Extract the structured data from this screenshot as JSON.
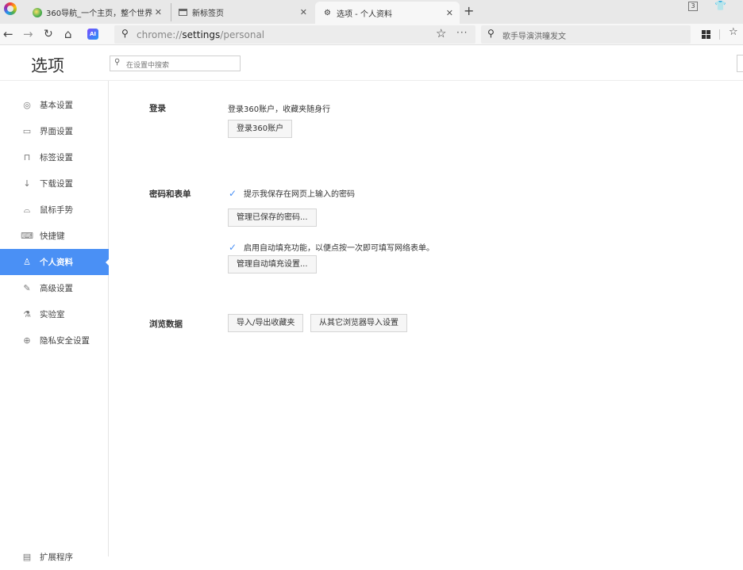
{
  "tabs": [
    {
      "title": "360导航_一个主页，整个世界",
      "icon": "globe-icon"
    },
    {
      "title": "新标签页",
      "icon": "newtab-page-icon"
    },
    {
      "title": "选项 - 个人资料",
      "icon": "settings-gear-icon"
    }
  ],
  "window": {
    "badge": "3"
  },
  "toolbar": {
    "url_scheme": "chrome://",
    "url_host": "settings",
    "url_path": "/personal",
    "ai_label": "AI",
    "search_placeholder": "歌手导演洪曈发文"
  },
  "page": {
    "title": "选项",
    "search_placeholder": "在设置中搜索"
  },
  "sidebar": {
    "items": [
      {
        "label": "基本设置",
        "icon": "gear-icon",
        "glyph": "◎"
      },
      {
        "label": "界面设置",
        "icon": "window-icon",
        "glyph": "▭"
      },
      {
        "label": "标签设置",
        "icon": "tab-icon",
        "glyph": "⊓"
      },
      {
        "label": "下载设置",
        "icon": "download-icon",
        "glyph": "↓"
      },
      {
        "label": "鼠标手势",
        "icon": "mouse-icon",
        "glyph": "⌓"
      },
      {
        "label": "快捷键",
        "icon": "keyboard-icon",
        "glyph": "⌨"
      },
      {
        "label": "个人资料",
        "icon": "user-icon",
        "glyph": "♙",
        "active": true
      },
      {
        "label": "高级设置",
        "icon": "wrench-icon",
        "glyph": "✎"
      },
      {
        "label": "实验室",
        "icon": "flask-icon",
        "glyph": "⚗"
      },
      {
        "label": "隐私安全设置",
        "icon": "shield-plus-icon",
        "glyph": "⊕"
      },
      {
        "label": "扩展程序",
        "icon": "extension-icon",
        "glyph": "▤"
      }
    ]
  },
  "login": {
    "label": "登录",
    "desc": "登录360账户，收藏夹随身行",
    "button": "登录360账户"
  },
  "passwords": {
    "label": "密码和表单",
    "save_passwords_checkbox": "提示我保存在网页上输入的密码",
    "manage_passwords_button": "管理已保存的密码...",
    "autofill_checkbox": "启用自动填充功能，以便点按一次即可填写网络表单。",
    "manage_autofill_button": "管理自动填充设置..."
  },
  "browsing_data": {
    "label": "浏览数据",
    "import_export_button": "导入/导出收藏夹",
    "import_from_other_button": "从其它浏览器导入设置"
  }
}
